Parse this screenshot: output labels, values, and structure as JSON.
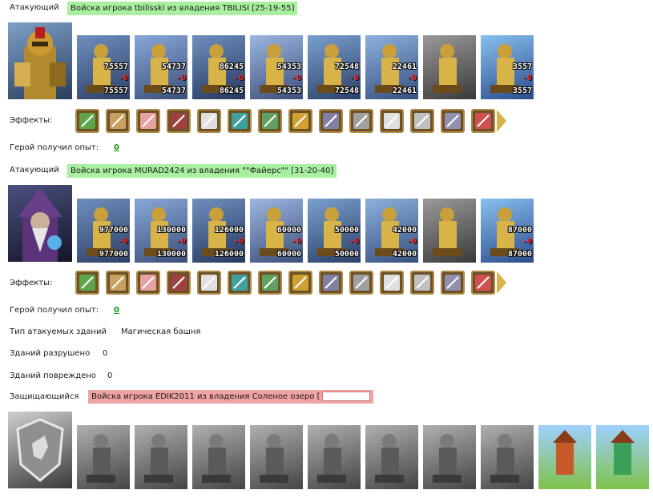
{
  "labels": {
    "attacker": "Атакующий",
    "effects": "Эффекты:",
    "hero_exp": "Герой получил опыт:",
    "building_type": "Тип атакуемых зданий",
    "buildings_destroyed": "Зданий разрушено",
    "buildings_damaged": "Зданий повреждено",
    "defender": "Защищающийся"
  },
  "block1": {
    "title": "Войска игрока tbilisski из владения TBILISI [25-19-55]",
    "exp": "0",
    "units": [
      {
        "top": "75557",
        "loss": "0",
        "bot": "75557"
      },
      {
        "top": "54737",
        "loss": "0",
        "bot": "54737"
      },
      {
        "top": "86245",
        "loss": "0",
        "bot": "86245"
      },
      {
        "top": "54353",
        "loss": "0",
        "bot": "54353"
      },
      {
        "top": "72548",
        "loss": "0",
        "bot": "72548"
      },
      {
        "top": "22461",
        "loss": "0",
        "bot": "22461"
      },
      {
        "top": "",
        "loss": "",
        "bot": ""
      },
      {
        "top": "3557",
        "loss": "0",
        "bot": "3557"
      }
    ]
  },
  "block2": {
    "title": "Войска игрока MURAD2424 из владения \"\"Файерс\"\" [31-20-40]",
    "exp": "0",
    "units": [
      {
        "top": "977000",
        "loss": "0",
        "bot": "977000"
      },
      {
        "top": "130000",
        "loss": "0",
        "bot": "130000"
      },
      {
        "top": "126000",
        "loss": "0",
        "bot": "126000"
      },
      {
        "top": "60000",
        "loss": "0",
        "bot": "60000"
      },
      {
        "top": "50000",
        "loss": "0",
        "bot": "50000"
      },
      {
        "top": "42000",
        "loss": "0",
        "bot": "42000"
      },
      {
        "top": "",
        "loss": "",
        "bot": ""
      },
      {
        "top": "87000",
        "loss": "0",
        "bot": "87000"
      }
    ]
  },
  "buildings": {
    "type_value": "Магическая башня",
    "destroyed": "0",
    "damaged": "0"
  },
  "defender_title": "Войска игрока EDIK2011 из владения Соленое озеро [",
  "colors": {
    "green_tag": "#a8f0a0",
    "red_tag": "#f0a3a3",
    "exp_link": "#119911"
  }
}
